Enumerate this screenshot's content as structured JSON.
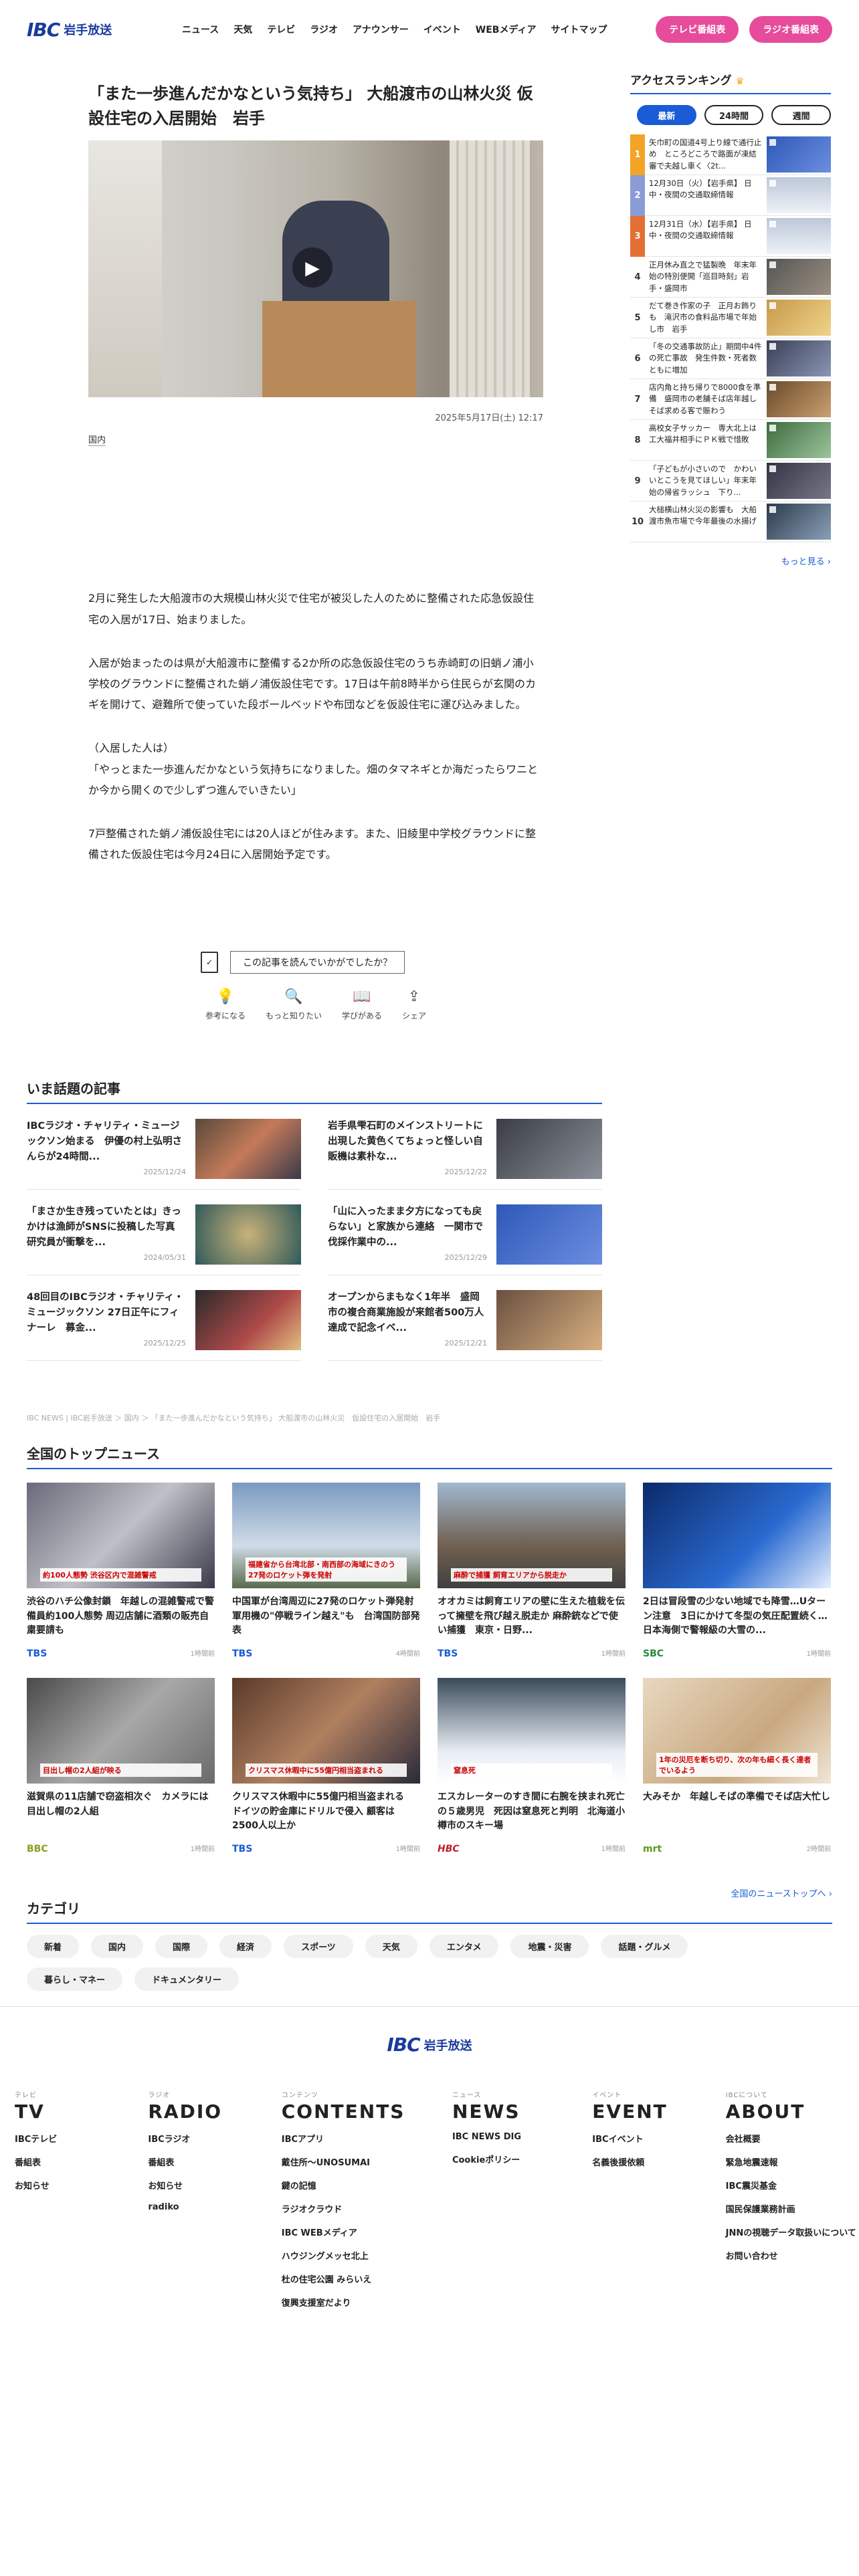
{
  "header": {
    "logo_mark": "IBC",
    "logo_text": "岩手放送",
    "nav": [
      "ニュース",
      "天気",
      "テレビ",
      "ラジオ",
      "アナウンサー",
      "イベント",
      "WEBメディア",
      "サイトマップ"
    ],
    "tv_program_button": "テレビ番組表",
    "radio_program_button": "ラジオ番組表"
  },
  "article": {
    "title": "「また一歩進んだかなという気持ち」 大船渡市の山林火災 仮設住宅の入居開始　岩手",
    "date": "2025年5月17日(土) 12:17",
    "category": "国内",
    "paragraphs": [
      "2月に発生した大船渡市の大規模山林火災で住宅が被災した人のために整備された応急仮設住宅の入居が17日、始まりました。",
      "入居が始まったのは県が大船渡市に整備する2か所の応急仮設住宅のうち赤崎町の旧蛸ノ浦小学校のグラウンドに整備された蛸ノ浦仮設住宅です。17日は午前8時半から住民らが玄関のカギを開けて、避難所で使っていた段ボールベッドや布団などを仮設住宅に運び込みました。",
      "（入居した人は）\n「やっとまた一歩進んだかなという気持ちになりました。畑のタマネギとか海だったらワニとか今から開くので少しずつ進んでいきたい」",
      "7戸整備された蛸ノ浦仮設住宅には20人ほどが住みます。また、旧綾里中学校グラウンドに整備された仮設住宅は今月24日に入居開始予定です。"
    ]
  },
  "feedback": {
    "question": "この記事を読んでいかがでしたか？",
    "actions": [
      "参考になる",
      "もっと知りたい",
      "学びがある",
      "シェア"
    ]
  },
  "ranking": {
    "title": "アクセスランキング",
    "tabs": [
      "最新",
      "24時間",
      "週間"
    ],
    "active_tab": "最新",
    "items": [
      {
        "num": "1",
        "text": "矢巾町の国道4号上り線で通行止め　ところどころで路面が凍結　審で夫越し車く〈2t..."
      },
      {
        "num": "2",
        "text": "12月30日（火）【岩手県】 日中・夜間の交通取締情報"
      },
      {
        "num": "3",
        "text": "12月31日（水）【岩手県】 日中・夜間の交通取締情報"
      },
      {
        "num": "4",
        "text": "正月休み直之で猛製晩　年末年始の特別便開「巡目時刻」岩手・盛岡市"
      },
      {
        "num": "5",
        "text": "だて巻き作家の子　正月お飾りも　滝沢市の食料品市場で年始し市　岩手"
      },
      {
        "num": "6",
        "text": "「冬の交通事故防止」期間中4件の死亡事故　発生件数・死者数ともに増加"
      },
      {
        "num": "7",
        "text": "店内角と持ち帰りで8000食を準備　盛岡市の老舗そば店年越しそば求める客で賑わう"
      },
      {
        "num": "8",
        "text": "高校女子サッカー　専大北上は工大福井相手にＰＫ戦で惜敗"
      },
      {
        "num": "9",
        "text": "「子どもが小さいので　かわいいとこうを見てほしい」年末年始の帰省ラッシュ　下り..."
      },
      {
        "num": "10",
        "text": "大槌横山林火災の影響も　大船渡市魚市場で今年最後の水揚げ"
      }
    ],
    "more": "もっと見る ›"
  },
  "trending": {
    "title": "いま話題の記事",
    "items": [
      {
        "title": "IBCラジオ・チャリティ・ミュージックソン始まる　伊優の村上弘明さんらが24時間...",
        "date": "2025/12/24"
      },
      {
        "title": "岩手県雫石町のメインストリートに出現した黄色くてちょっと怪しい自販機は素朴な...",
        "date": "2025/12/22"
      },
      {
        "title": "「まさか生き残っていたとは」きっかけは漁師がSNSに投稿した写真　研究員が衝撃を...",
        "date": "2024/05/31"
      },
      {
        "title": "「山に入ったまま夕方になっても戻らない」と家族から連絡　一関市で伐採作業中の...",
        "date": "2025/12/29"
      },
      {
        "title": "48回目のIBCラジオ・チャリティ・ミュージックソン 27日正午にフィナーレ　募金...",
        "date": "2025/12/25"
      },
      {
        "title": "オープンからまもなく1年半　盛岡市の複合商業施設が来館者500万人達成で記念イベ...",
        "date": "2025/12/21"
      }
    ]
  },
  "breadcrumb": "IBC NEWS | IBC岩手放送 ＞ 国内 ＞ 「また一歩進んだかなという気持ち」 大船渡市の山林火災　仮設住宅の入居開始　岩手",
  "topnews": {
    "title": "全国のトップニュース",
    "items": [
      {
        "title": "渋谷のハチ公像封鎖　年越しの混雑警戒で警備員約100人態勢 周辺店舗に酒類の販売自粛要請も",
        "source": "TBS",
        "time": "1時間前",
        "caption": "約100人態勢 渋谷区内で混雑警戒"
      },
      {
        "title": "中国軍が台湾周辺に27発のロケット弾発射　軍用機の\"停戦ライン越え\"も　台湾国防部発表",
        "source": "TBS",
        "time": "4時間前",
        "caption": "福建省から台湾北部・南西部の海域にきのう27発のロケット弾を発射"
      },
      {
        "title": "オオカミは飼育エリアの壁に生えた植栽を伝って擁壁を飛び越え脱走か 麻酔銃などで使い捕獲　東京・日野...",
        "source": "TBS",
        "time": "1時間前",
        "caption": "麻酔で捕獲 飼育エリアから脱走か"
      },
      {
        "title": "2日は冒段雪の少ない地域でも降雪…Uターン注意　3日にかけて冬型の気圧配置続く…日本海側で警報級の大雪の...",
        "source": "SBC",
        "time": "1時間前",
        "caption": ""
      },
      {
        "title": "滋賀県の11店舗で窃盗相次ぐ　カメラには目出し帽の2人組",
        "source": "BBC",
        "time": "1時間前",
        "caption": "目出し帽の2人組が映る"
      },
      {
        "title": "クリスマス休暇中に55億円相当盗まれる　ドイツの貯金庫にドリルで侵入 顧客は2500人以上か",
        "source": "TBS",
        "time": "1時間前",
        "caption": "クリスマス休暇中に55億円相当盗まれる"
      },
      {
        "title": "エスカレーターのすき間に右腕を挟まれ死亡の５歳男児　死因は窒息死と判明　北海道小樽市のスキー場",
        "source": "HBC",
        "time": "1時間前",
        "caption": "窒息死"
      },
      {
        "title": "大みそか　年越しそばの準備でそば店大忙し",
        "source": "mrt",
        "time": "2時間前",
        "caption": "1年の災厄を断ち切り、次の年も細く長く達者でいるよう"
      }
    ],
    "more": "全国のニューストップへ ›"
  },
  "category": {
    "title": "カテゴリ",
    "chips": [
      "新着",
      "国内",
      "国際",
      "経済",
      "スポーツ",
      "天気",
      "エンタメ",
      "地震・災害",
      "話題・グルメ",
      "暮らし・マネー",
      "ドキュメンタリー"
    ]
  },
  "footer": {
    "logo_mark": "IBC",
    "logo_text": "岩手放送",
    "columns": [
      {
        "sub": "テレビ",
        "heading": "TV",
        "links": [
          "IBCテレビ",
          "番組表",
          "お知らせ"
        ]
      },
      {
        "sub": "ラジオ",
        "heading": "RADIO",
        "links": [
          "IBCラジオ",
          "番組表",
          "お知らせ",
          "radiko"
        ]
      },
      {
        "sub": "コンテンツ",
        "heading": "CONTENTS",
        "links": [
          "IBCアプリ",
          "戴住所〜UNOSUMAI",
          "鍵の記憶",
          "ラジオクラウド",
          "IBC WEBメディア",
          "ハウジングメッセ北上",
          "杜の住宅公園 みらいえ",
          "復興支援室だより"
        ]
      },
      {
        "sub": "ニュース",
        "heading": "NEWS",
        "links": [
          "IBC NEWS DIG",
          "Cookieポリシー"
        ]
      },
      {
        "sub": "イベント",
        "heading": "EVENT",
        "links": [
          "IBCイベント",
          "名義後援依頼"
        ]
      },
      {
        "sub": "IBCについて",
        "heading": "ABOUT",
        "links": [
          "会社概要",
          "緊急地震速報",
          "IBC震災基金",
          "国民保護業務計画",
          "JNNの視聴データ取扱いについて",
          "お問い合わせ"
        ]
      }
    ]
  },
  "colors": {
    "accent": "#1a5bd6",
    "pink": "#e64c9b",
    "brand": "#1a3b9c"
  }
}
